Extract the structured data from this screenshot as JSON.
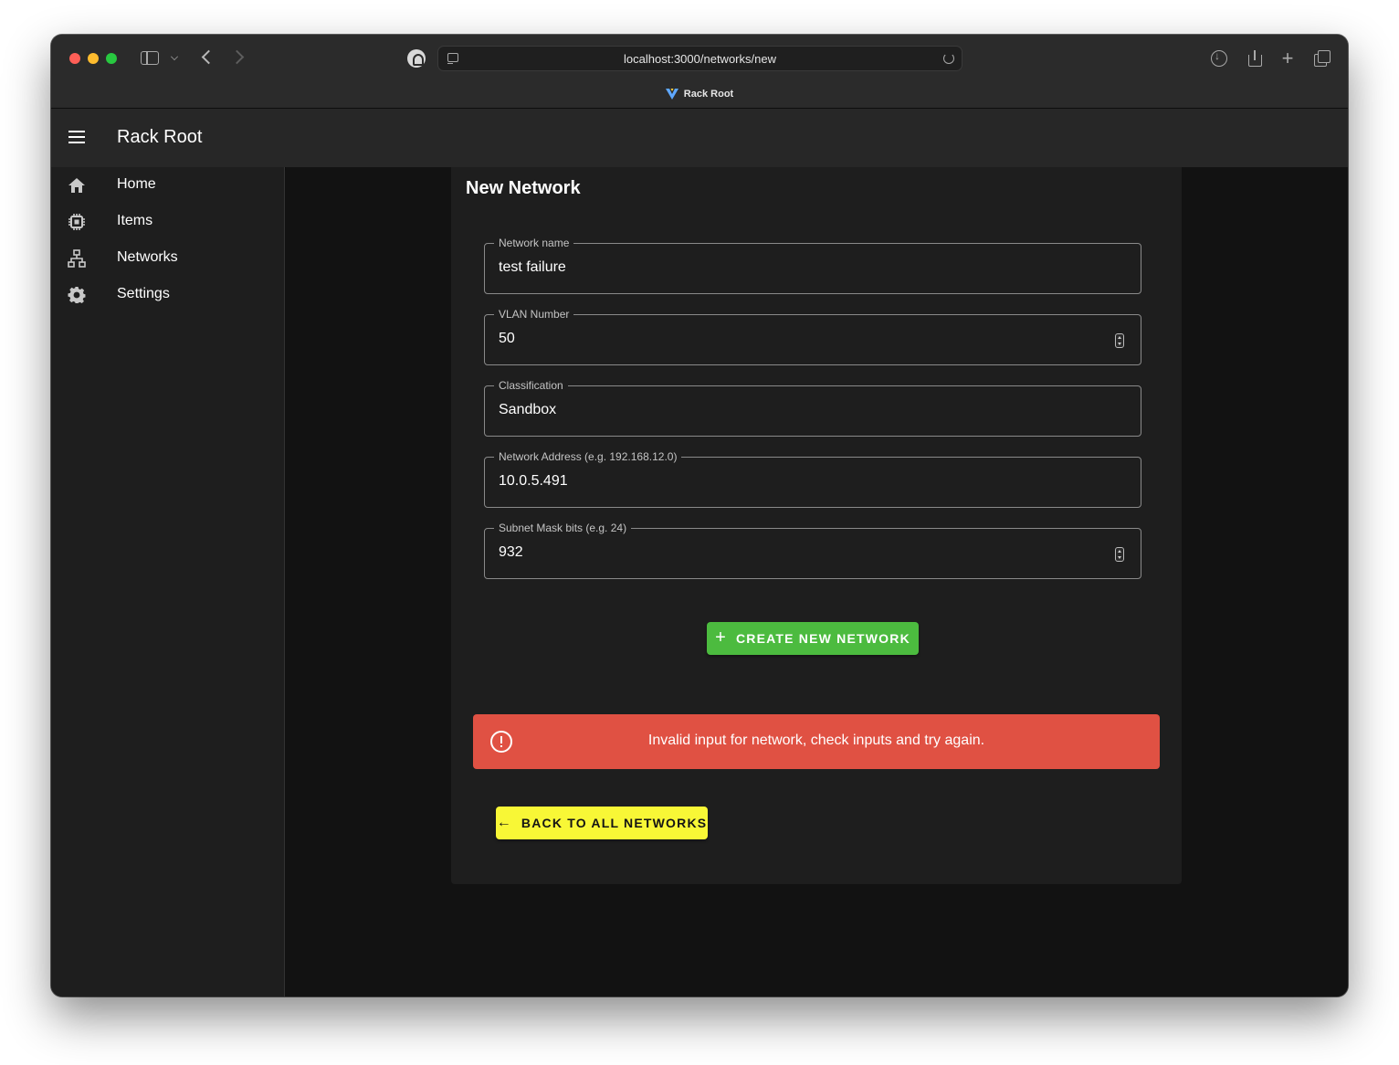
{
  "browser": {
    "url": "localhost:3000/networks/new",
    "tab_title": "Rack Root"
  },
  "app": {
    "title": "Rack Root",
    "sidebar": {
      "items": [
        {
          "label": "Home",
          "icon": "home-icon"
        },
        {
          "label": "Items",
          "icon": "chip-icon"
        },
        {
          "label": "Networks",
          "icon": "network-icon"
        },
        {
          "label": "Settings",
          "icon": "gear-icon"
        }
      ]
    }
  },
  "form": {
    "title": "New Network",
    "fields": [
      {
        "label": "Network name",
        "value": "test failure"
      },
      {
        "label": "VLAN Number",
        "value": "50"
      },
      {
        "label": "Classification",
        "value": "Sandbox"
      },
      {
        "label": "Network Address (e.g. 192.168.12.0)",
        "value": "10.0.5.491"
      },
      {
        "label": "Subnet Mask bits (e.g. 24)",
        "value": "932"
      }
    ],
    "create_button": "CREATE NEW NETWORK",
    "error_message": "Invalid input for network, check inputs and try again.",
    "back_button": "BACK TO ALL NETWORKS"
  },
  "colors": {
    "create_button": "#4cbb3f",
    "error_alert": "#e05143",
    "back_button": "#f8f736",
    "app_background": "#121212",
    "surface": "#1e1e1e"
  }
}
